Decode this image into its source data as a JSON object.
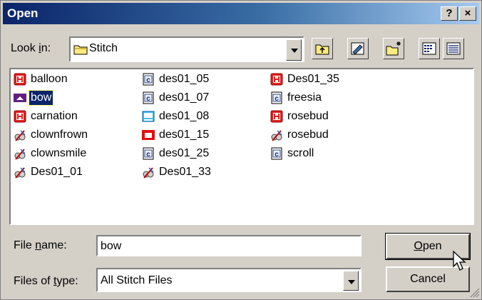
{
  "window": {
    "title": "Open",
    "help_label": "?",
    "close_label": "×"
  },
  "look_in": {
    "label_pre": "Look ",
    "label_accel": "i",
    "label_post": "n:",
    "value": "Stitch"
  },
  "files": [
    {
      "name": "balloon",
      "icon": "h-logo-icon"
    },
    {
      "name": "bow",
      "icon": "bow-image-icon",
      "selected": true
    },
    {
      "name": "carnation",
      "icon": "h-logo-icon"
    },
    {
      "name": "clownfrown",
      "icon": "embroidery-icon"
    },
    {
      "name": "clownsmile",
      "icon": "embroidery-icon"
    },
    {
      "name": "Des01_01",
      "icon": "embroidery-icon"
    },
    {
      "name": "des01_05",
      "icon": "c-document-icon"
    },
    {
      "name": "des01_07",
      "icon": "c-document-icon"
    },
    {
      "name": "des01_08",
      "icon": "picture-icon"
    },
    {
      "name": "des01_15",
      "icon": "red-image-icon"
    },
    {
      "name": "des01_25",
      "icon": "c-document-icon"
    },
    {
      "name": "Des01_33",
      "icon": "embroidery-icon"
    },
    {
      "name": "Des01_35",
      "icon": "h-logo-icon"
    },
    {
      "name": "freesia",
      "icon": "c-document-icon"
    },
    {
      "name": "rosebud",
      "icon": "h-logo-icon"
    },
    {
      "name": "rosebud",
      "icon": "embroidery-icon"
    },
    {
      "name": "scroll",
      "icon": "c-document-icon"
    }
  ],
  "file_name": {
    "label_pre": "File ",
    "label_accel": "n",
    "label_post": "ame:",
    "value": "bow"
  },
  "file_type": {
    "label_pre": "Files of ",
    "label_accel": "t",
    "label_post": "ype:",
    "value": "All Stitch Files"
  },
  "buttons": {
    "open_accel": "O",
    "open_rest": "pen",
    "cancel": "Cancel"
  }
}
